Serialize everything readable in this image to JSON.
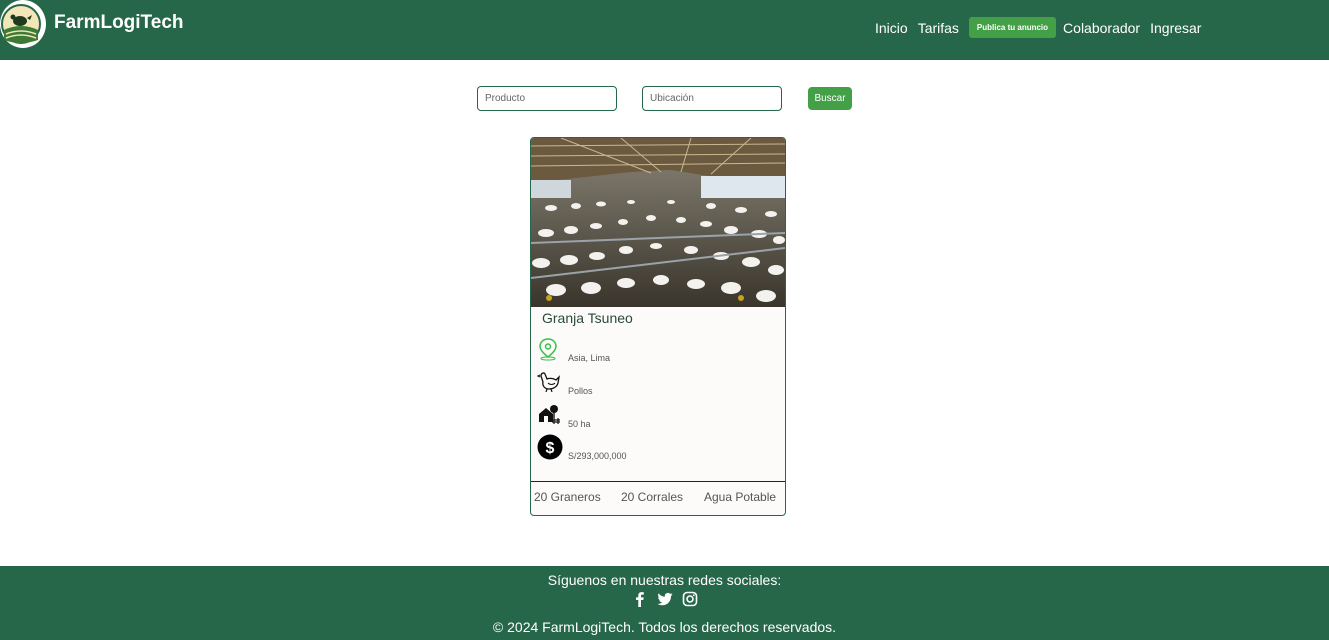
{
  "header": {
    "brand": "FarmLogiTech",
    "nav": {
      "inicio": "Inicio",
      "tarifas": "Tarifas",
      "publish": "Publica tu anuncio",
      "colaborador": "Colaborador",
      "ingresar": "Ingresar"
    }
  },
  "search": {
    "product_placeholder": "Producto",
    "location_placeholder": "Ubicación",
    "button": "Buscar"
  },
  "listing": {
    "title": "Granja Tsuneo",
    "location": "Asia, Lima",
    "animal": "Pollos",
    "area": "50 ha",
    "price": "S/293,000,000",
    "features": [
      "20 Graneros",
      "20 Corrales",
      "Agua Potable"
    ],
    "icons": [
      "location-pin-icon",
      "chicken-icon",
      "farm-icon",
      "dollar-icon"
    ]
  },
  "footer": {
    "title": "Síguenos en nuestras redes sociales:",
    "socials": [
      "facebook-icon",
      "twitter-icon",
      "instagram-icon"
    ],
    "copyright": "© 2024 FarmLogiTech. Todos los derechos reservados."
  },
  "colors": {
    "primary": "#276749",
    "accent": "#43a047"
  }
}
